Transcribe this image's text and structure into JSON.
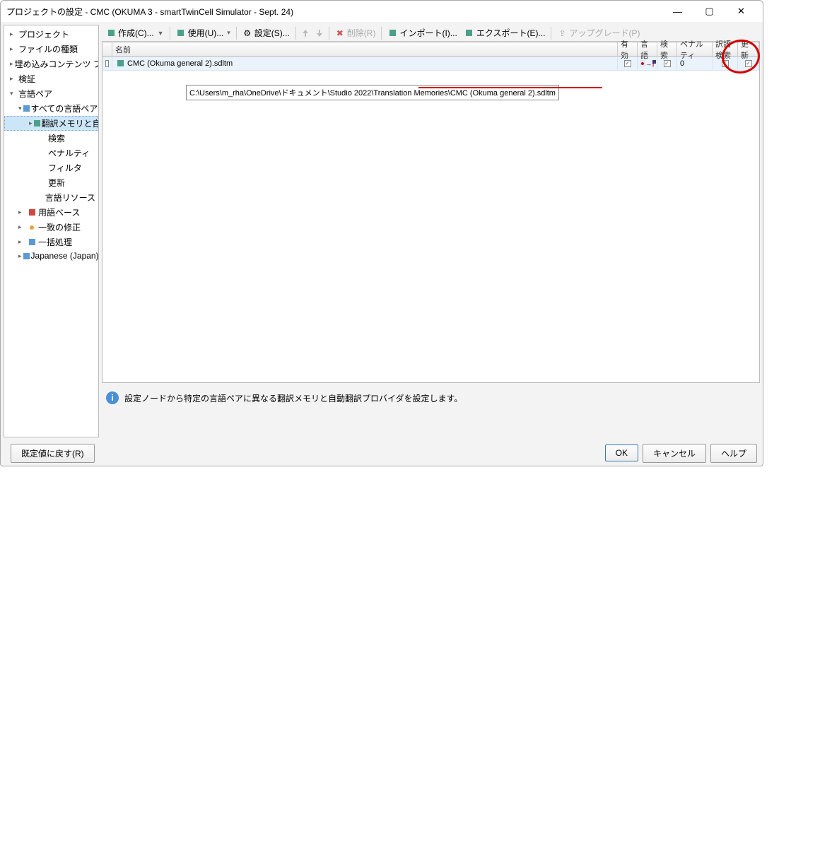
{
  "window": {
    "title": "プロジェクトの設定 - CMC (OKUMA 3 - smartTwinCell Simulator - Sept. 24)"
  },
  "sidebar": {
    "items": [
      {
        "label": "プロジェクト"
      },
      {
        "label": "ファイルの種類"
      },
      {
        "label": "埋め込みコンテンツ プロセッ"
      },
      {
        "label": "検証"
      },
      {
        "label": "言語ペア"
      },
      {
        "label": "すべての言語ペア"
      },
      {
        "label": "翻訳メモリと自動翻訳"
      },
      {
        "label": "検索"
      },
      {
        "label": "ペナルティ"
      },
      {
        "label": "フィルタ"
      },
      {
        "label": "更新"
      },
      {
        "label": "言語リソース"
      },
      {
        "label": "用語ベース"
      },
      {
        "label": "一致の修正"
      },
      {
        "label": "一括処理"
      },
      {
        "label": "Japanese (Japan)->En"
      }
    ]
  },
  "toolbar": {
    "create": "作成(C)...",
    "use": "使用(U)...",
    "settings": "設定(S)...",
    "delete": "削除(R)",
    "import": "インポート(I)...",
    "export": "エクスポート(E)...",
    "upgrade": "アップグレード(P)"
  },
  "grid": {
    "headers": {
      "name": "名前",
      "enabled": "有効",
      "lang": "言語",
      "search": "検索",
      "penalty": "ペナルティ",
      "termsearch": "訳語検索",
      "update": "更新"
    },
    "rows": [
      {
        "name": "CMC (Okuma general 2).sdltm",
        "penalty": "0"
      }
    ],
    "tooltip": "C:\\Users\\m_rha\\OneDrive\\ドキュメント\\Studio 2022\\Translation Memories\\CMC (Okuma general 2).sdltm"
  },
  "info": {
    "text": "設定ノードから特定の言語ペアに異なる翻訳メモリと自動翻訳プロバイダを設定します。"
  },
  "footer": {
    "reset": "既定値に戻す(R)",
    "ok": "OK",
    "cancel": "キャンセル",
    "help": "ヘルプ"
  }
}
